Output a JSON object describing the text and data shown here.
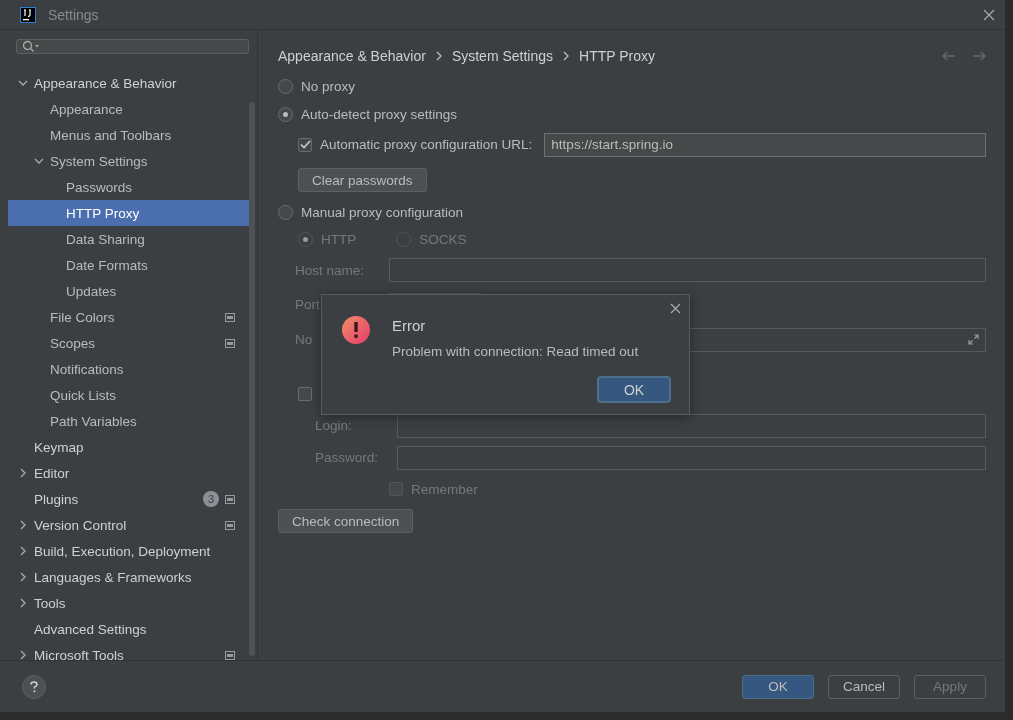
{
  "window": {
    "title": "Settings"
  },
  "sidebar": {
    "tree": [
      {
        "label": "Appearance & Behavior",
        "expanded": true,
        "selected": false,
        "children": [
          {
            "label": "Appearance",
            "selected": false
          },
          {
            "label": "Menus and Toolbars",
            "selected": false
          },
          {
            "label": "System Settings",
            "expanded": true,
            "selected": false,
            "children": [
              {
                "label": "Passwords",
                "selected": false
              },
              {
                "label": "HTTP Proxy",
                "selected": true
              },
              {
                "label": "Data Sharing",
                "selected": false
              },
              {
                "label": "Date Formats",
                "selected": false
              },
              {
                "label": "Updates",
                "selected": false
              }
            ]
          },
          {
            "label": "File Colors",
            "selected": false,
            "project_level": true
          },
          {
            "label": "Scopes",
            "selected": false,
            "project_level": true
          },
          {
            "label": "Notifications",
            "selected": false
          },
          {
            "label": "Quick Lists",
            "selected": false
          },
          {
            "label": "Path Variables",
            "selected": false
          }
        ]
      },
      {
        "label": "Keymap",
        "selected": false
      },
      {
        "label": "Editor",
        "expanded": false,
        "selected": false
      },
      {
        "label": "Plugins",
        "selected": false,
        "badge": "3",
        "project_level": true
      },
      {
        "label": "Version Control",
        "expanded": false,
        "selected": false,
        "project_level": true
      },
      {
        "label": "Build, Execution, Deployment",
        "expanded": false,
        "selected": false
      },
      {
        "label": "Languages & Frameworks",
        "expanded": false,
        "selected": false
      },
      {
        "label": "Tools",
        "expanded": false,
        "selected": false
      },
      {
        "label": "Advanced Settings",
        "selected": false
      },
      {
        "label": "Microsoft Tools",
        "expanded": false,
        "selected": false,
        "project_level": true
      }
    ]
  },
  "breadcrumb": [
    "Appearance & Behavior",
    "System Settings",
    "HTTP Proxy"
  ],
  "proxy_modes": [
    {
      "label": "No proxy",
      "selected": false
    },
    {
      "label": "Auto-detect proxy settings",
      "selected": true
    },
    {
      "label": "Manual proxy configuration",
      "selected": false
    }
  ],
  "auto_detect": {
    "pac_url": {
      "label": "Automatic proxy configuration URL:",
      "checked": true,
      "value": "https://start.spring.io"
    },
    "clear_button": "Clear passwords"
  },
  "manual": {
    "disabled": true,
    "protocols": [
      {
        "label": "HTTP",
        "selected": true
      },
      {
        "label": "SOCKS",
        "selected": false
      }
    ],
    "host_label": "Host name:",
    "port_label": "Port",
    "no_proxy_label": "No",
    "auth": {
      "checked": false
    },
    "login_label": "Login:",
    "password_label": "Password:",
    "remember": {
      "label": "Remember",
      "checked": false
    }
  },
  "check_button": "Check connection",
  "dialog": {
    "title": "Error",
    "message": "Problem with connection: Read timed out",
    "button": "OK"
  },
  "footer_buttons": [
    {
      "label": "OK",
      "kind": "primary"
    },
    {
      "label": "Cancel",
      "kind": "normal"
    },
    {
      "label": "Apply",
      "kind": "disabled"
    }
  ]
}
